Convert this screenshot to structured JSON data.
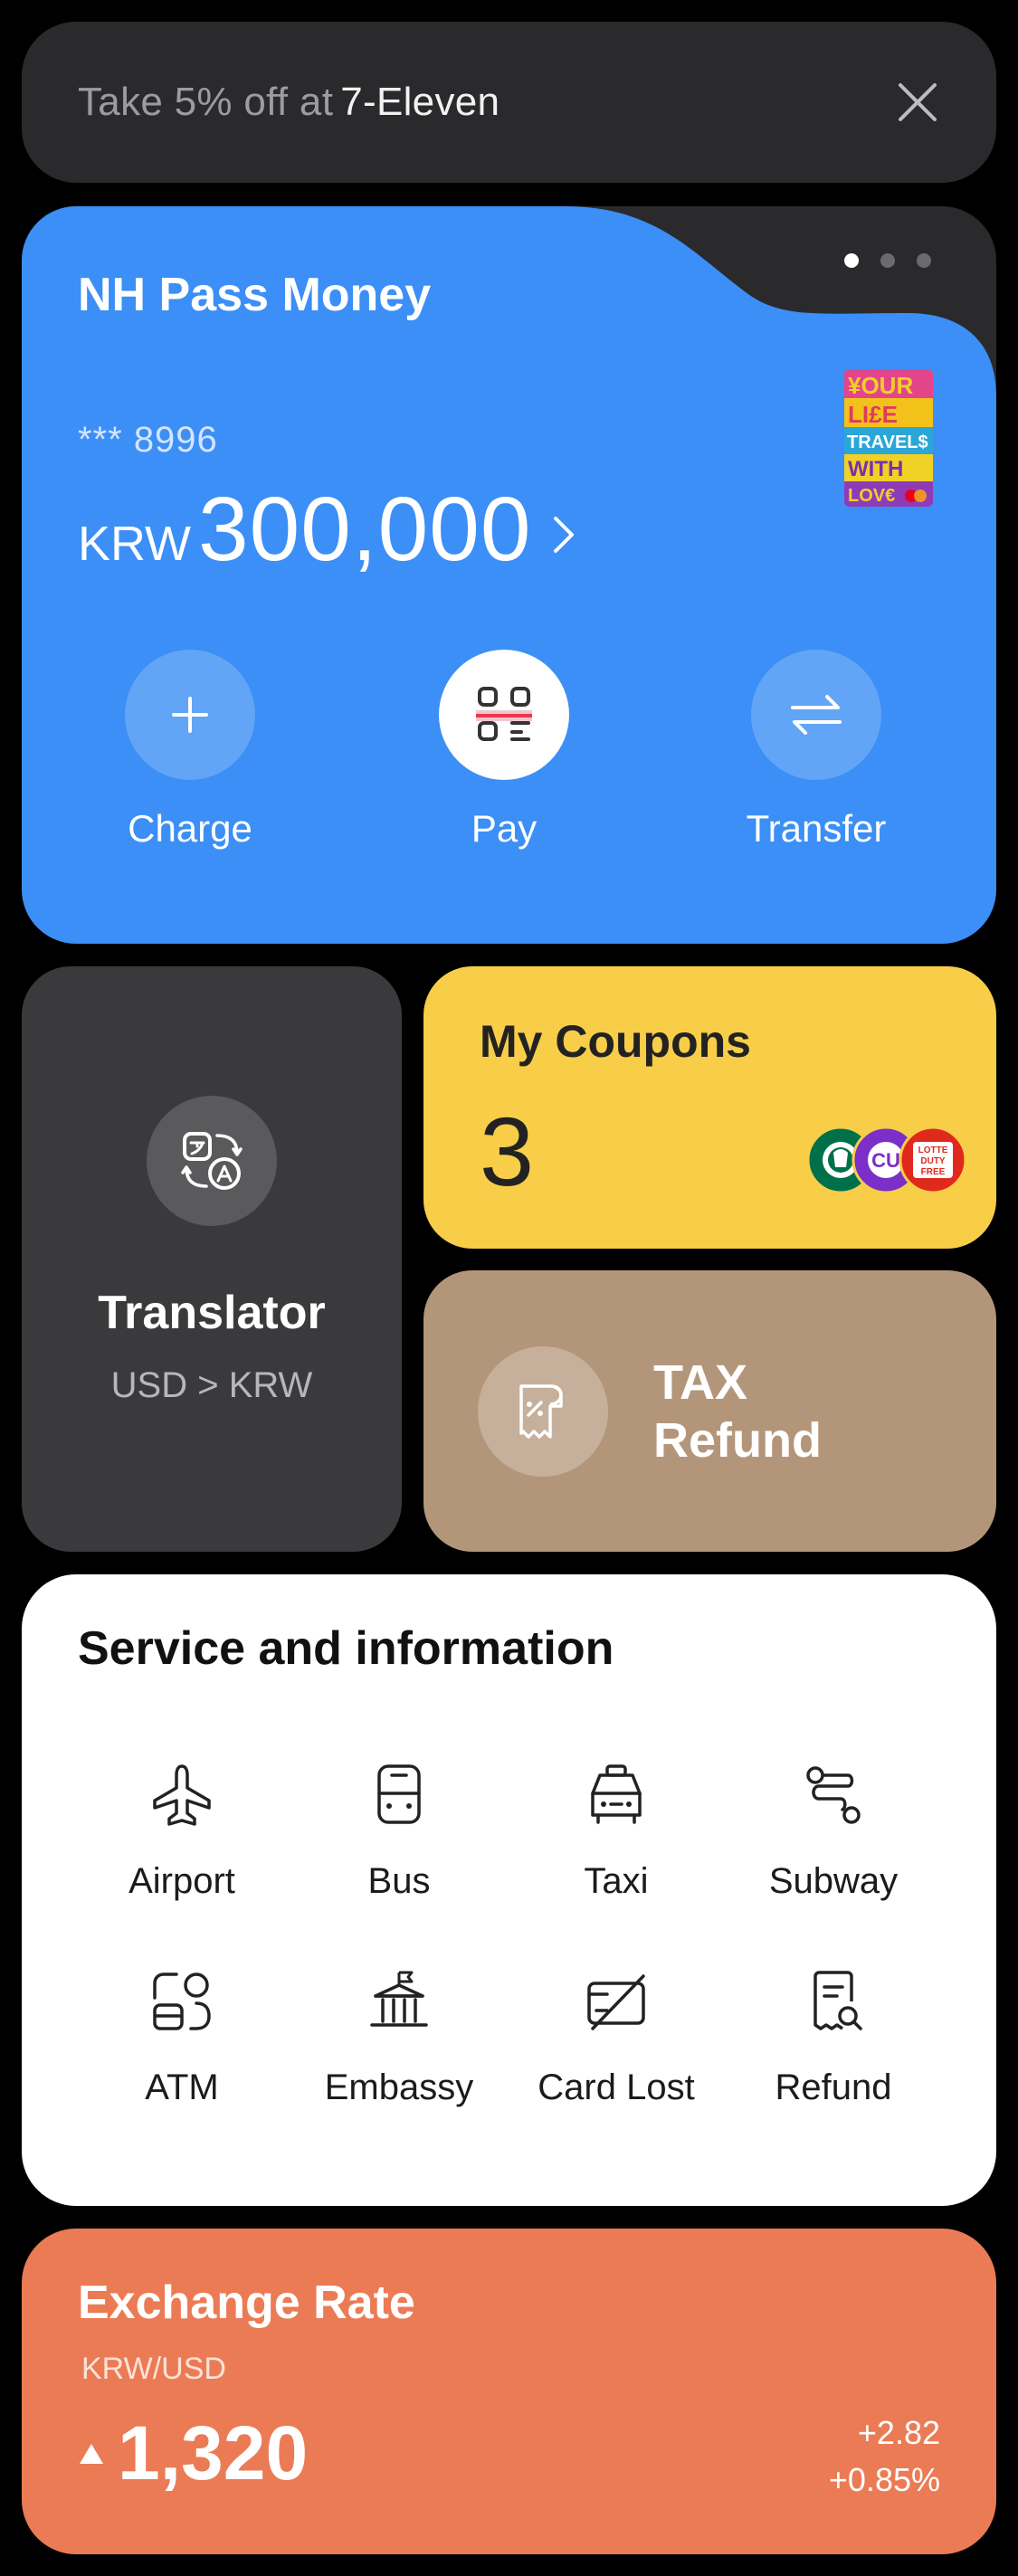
{
  "promo": {
    "prefix": "Take 5% off at",
    "store": "7-Eleven"
  },
  "wallet": {
    "title": "NH Pass Money",
    "account_masked": "*** 8996",
    "currency": "KRW",
    "balance": "300,000",
    "card_art_text": [
      "¥OUR",
      "LI£E",
      "TRAVEL$",
      "WITH",
      "LOV€"
    ],
    "page_indicator": {
      "total": 3,
      "active": 1
    },
    "actions": [
      {
        "label": "Charge"
      },
      {
        "label": "Pay"
      },
      {
        "label": "Transfer"
      }
    ],
    "colors": {
      "card": "#3b8ff6",
      "accent_red": "#e8384f"
    }
  },
  "translator": {
    "title": "Translator",
    "subtitle": "USD > KRW"
  },
  "coupons": {
    "title": "My Coupons",
    "count": "3",
    "brand_logos": [
      "starbucks-logo",
      "cu-logo",
      "lotte-duty-free-logo"
    ],
    "lotte_logo_text": [
      "LOTTE",
      "DUTY",
      "FREE"
    ],
    "cu_logo_text": "CU"
  },
  "tax_refund": {
    "line1": "TAX",
    "line2": "Refund"
  },
  "services": {
    "title": "Service and information",
    "items": [
      {
        "label": "Airport",
        "icon": "airplane-icon"
      },
      {
        "label": "Bus",
        "icon": "bus-icon"
      },
      {
        "label": "Taxi",
        "icon": "taxi-icon"
      },
      {
        "label": "Subway",
        "icon": "subway-route-icon"
      },
      {
        "label": "ATM",
        "icon": "atm-icon"
      },
      {
        "label": "Embassy",
        "icon": "embassy-icon"
      },
      {
        "label": "Card Lost",
        "icon": "card-lost-icon"
      },
      {
        "label": "Refund",
        "icon": "refund-receipt-icon"
      }
    ]
  },
  "exchange": {
    "title": "Exchange Rate",
    "pair": "KRW/USD",
    "rate": "1,320",
    "change_abs": "+2.82",
    "change_pct": "+0.85%",
    "direction": "up"
  }
}
